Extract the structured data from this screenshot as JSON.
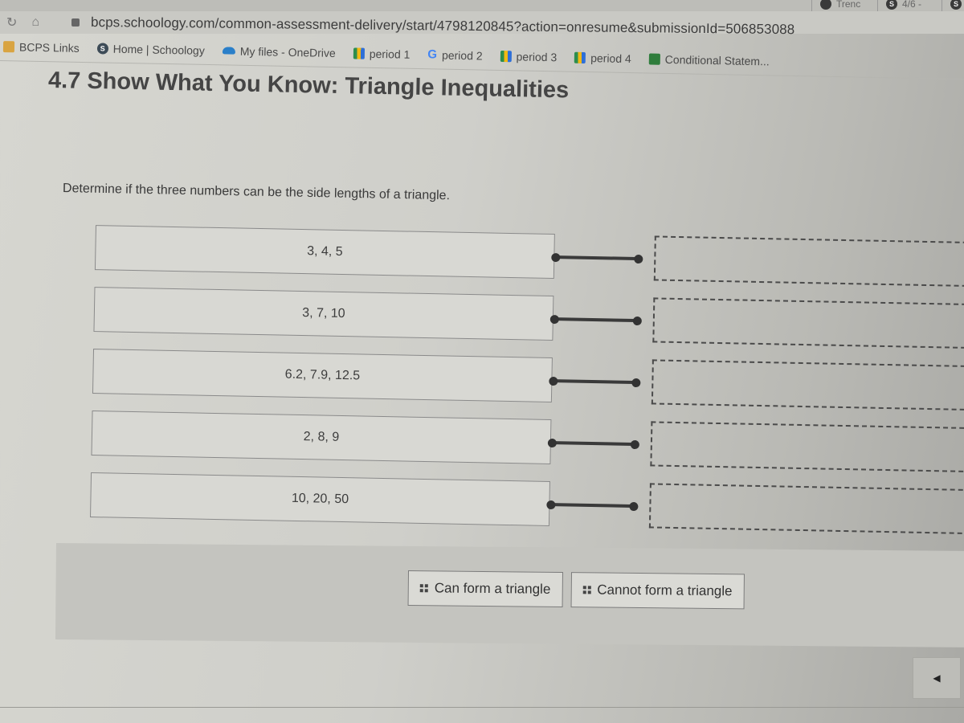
{
  "browser": {
    "tabs": [
      {
        "label": "Trenc",
        "icon": "circle-icon"
      },
      {
        "label": "4/6 -",
        "icon": "schoology-icon"
      },
      {
        "label": "",
        "icon": "schoology-icon"
      }
    ],
    "url": "bcps.schoology.com/common-assessment-delivery/start/4798120845?action=onresume&submissionId=506853088",
    "bookmarks": [
      {
        "label": "BCPS Links",
        "icon": "folder-icon"
      },
      {
        "label": "Home | Schoology",
        "icon": "schoology-icon"
      },
      {
        "label": "My files - OneDrive",
        "icon": "onedrive-icon"
      },
      {
        "label": "period 1",
        "icon": "google-meet-icon"
      },
      {
        "label": "period 2",
        "icon": "google-icon"
      },
      {
        "label": "period 3",
        "icon": "google-meet-icon"
      },
      {
        "label": "period 4",
        "icon": "google-meet-icon"
      },
      {
        "label": "Conditional Statem...",
        "icon": "classroom-icon"
      }
    ]
  },
  "page": {
    "title": "4.7 Show What You Know: Triangle Inequalities",
    "prompt": "Determine if the three numbers can be the side lengths of a triangle."
  },
  "matching": {
    "items": [
      {
        "label": "3, 4, 5",
        "answer": ""
      },
      {
        "label": "3, 7, 10",
        "answer": ""
      },
      {
        "label": "6.2, 7.9, 12.5",
        "answer": ""
      },
      {
        "label": "2, 8, 9",
        "answer": ""
      },
      {
        "label": "10, 20, 50",
        "answer": ""
      }
    ],
    "choices": [
      {
        "label": "Can form a triangle"
      },
      {
        "label": "Cannot form a triangle"
      }
    ]
  },
  "navigation": {
    "prev_icon": "◀"
  }
}
